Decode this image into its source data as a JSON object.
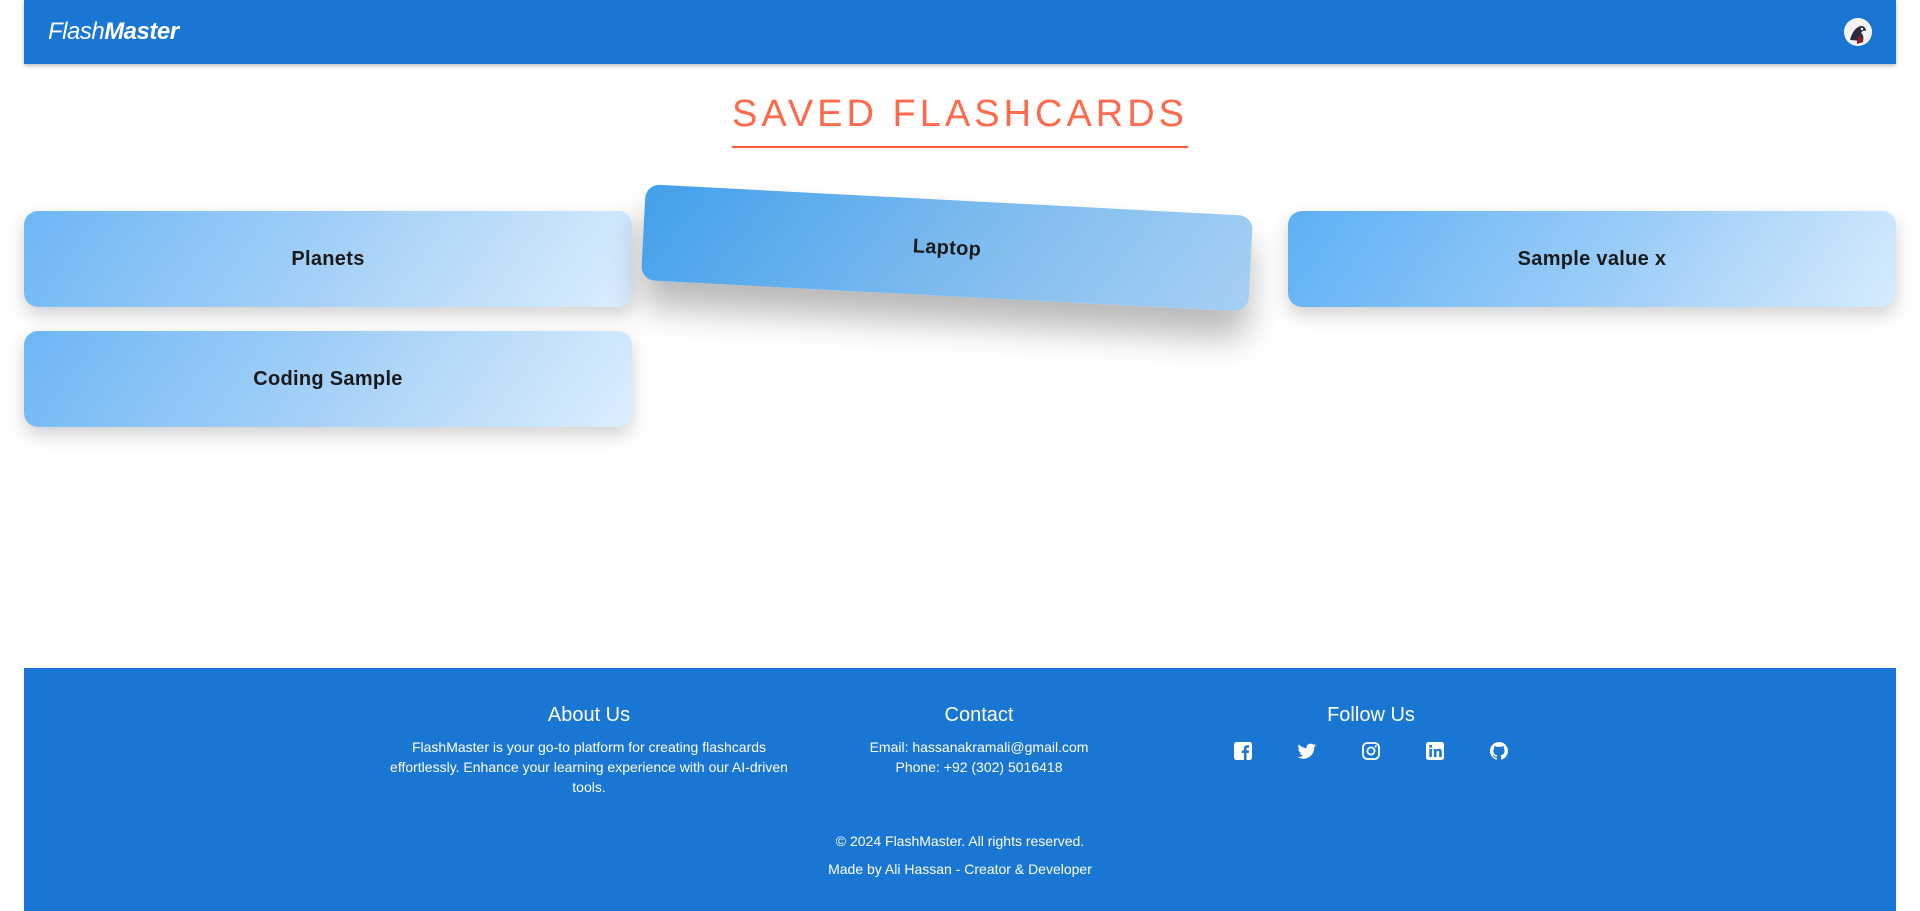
{
  "header": {
    "logo_light": "Flash",
    "logo_bold": "Master",
    "avatar_icon": "user-avatar"
  },
  "page": {
    "title": "SAVED FLASHCARDS"
  },
  "flashcards": [
    {
      "label": "Planets"
    },
    {
      "label": "Laptop"
    },
    {
      "label": "Sample value x"
    },
    {
      "label": "Coding Sample"
    }
  ],
  "footer": {
    "about": {
      "heading": "About Us",
      "text": "FlashMaster is your go-to platform for creating flashcards effortlessly. Enhance your learning experience with our AI-driven tools."
    },
    "contact": {
      "heading": "Contact",
      "email": "Email: hassanakramali@gmail.com",
      "phone": "Phone: +92 (302) 5016418"
    },
    "follow": {
      "heading": "Follow Us",
      "icons": [
        "facebook-icon",
        "twitter-icon",
        "instagram-icon",
        "linkedin-icon",
        "github-icon"
      ]
    },
    "copyright": "© 2024 FlashMaster. All rights reserved.",
    "credit": "Made by Ali Hassan - Creator & Developer"
  },
  "colors": {
    "primary": "#1976d2",
    "title_accent": "#ff6a4d",
    "card_start": "#6db6f5",
    "card_end": "#dceefd"
  }
}
